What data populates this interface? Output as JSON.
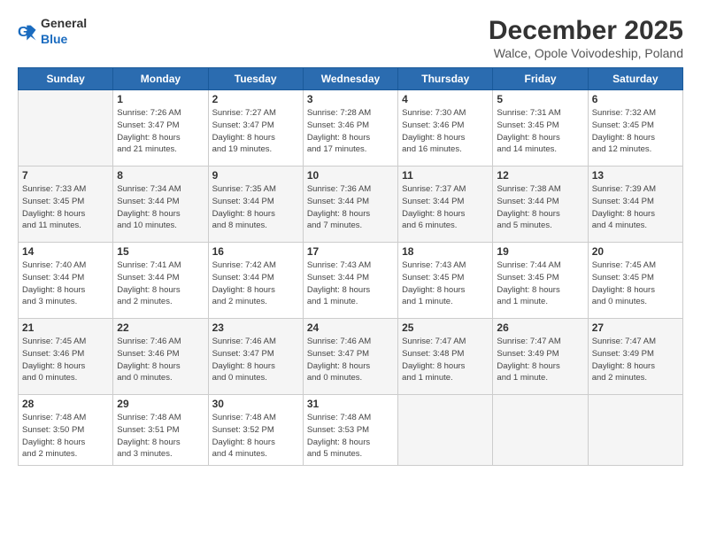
{
  "logo": {
    "general": "General",
    "blue": "Blue"
  },
  "header": {
    "month_year": "December 2025",
    "location": "Walce, Opole Voivodeship, Poland"
  },
  "days_of_week": [
    "Sunday",
    "Monday",
    "Tuesday",
    "Wednesday",
    "Thursday",
    "Friday",
    "Saturday"
  ],
  "weeks": [
    [
      {
        "day": "",
        "info": ""
      },
      {
        "day": "1",
        "info": "Sunrise: 7:26 AM\nSunset: 3:47 PM\nDaylight: 8 hours\nand 21 minutes."
      },
      {
        "day": "2",
        "info": "Sunrise: 7:27 AM\nSunset: 3:47 PM\nDaylight: 8 hours\nand 19 minutes."
      },
      {
        "day": "3",
        "info": "Sunrise: 7:28 AM\nSunset: 3:46 PM\nDaylight: 8 hours\nand 17 minutes."
      },
      {
        "day": "4",
        "info": "Sunrise: 7:30 AM\nSunset: 3:46 PM\nDaylight: 8 hours\nand 16 minutes."
      },
      {
        "day": "5",
        "info": "Sunrise: 7:31 AM\nSunset: 3:45 PM\nDaylight: 8 hours\nand 14 minutes."
      },
      {
        "day": "6",
        "info": "Sunrise: 7:32 AM\nSunset: 3:45 PM\nDaylight: 8 hours\nand 12 minutes."
      }
    ],
    [
      {
        "day": "7",
        "info": "Sunrise: 7:33 AM\nSunset: 3:45 PM\nDaylight: 8 hours\nand 11 minutes."
      },
      {
        "day": "8",
        "info": "Sunrise: 7:34 AM\nSunset: 3:44 PM\nDaylight: 8 hours\nand 10 minutes."
      },
      {
        "day": "9",
        "info": "Sunrise: 7:35 AM\nSunset: 3:44 PM\nDaylight: 8 hours\nand 8 minutes."
      },
      {
        "day": "10",
        "info": "Sunrise: 7:36 AM\nSunset: 3:44 PM\nDaylight: 8 hours\nand 7 minutes."
      },
      {
        "day": "11",
        "info": "Sunrise: 7:37 AM\nSunset: 3:44 PM\nDaylight: 8 hours\nand 6 minutes."
      },
      {
        "day": "12",
        "info": "Sunrise: 7:38 AM\nSunset: 3:44 PM\nDaylight: 8 hours\nand 5 minutes."
      },
      {
        "day": "13",
        "info": "Sunrise: 7:39 AM\nSunset: 3:44 PM\nDaylight: 8 hours\nand 4 minutes."
      }
    ],
    [
      {
        "day": "14",
        "info": "Sunrise: 7:40 AM\nSunset: 3:44 PM\nDaylight: 8 hours\nand 3 minutes."
      },
      {
        "day": "15",
        "info": "Sunrise: 7:41 AM\nSunset: 3:44 PM\nDaylight: 8 hours\nand 2 minutes."
      },
      {
        "day": "16",
        "info": "Sunrise: 7:42 AM\nSunset: 3:44 PM\nDaylight: 8 hours\nand 2 minutes."
      },
      {
        "day": "17",
        "info": "Sunrise: 7:43 AM\nSunset: 3:44 PM\nDaylight: 8 hours\nand 1 minute."
      },
      {
        "day": "18",
        "info": "Sunrise: 7:43 AM\nSunset: 3:45 PM\nDaylight: 8 hours\nand 1 minute."
      },
      {
        "day": "19",
        "info": "Sunrise: 7:44 AM\nSunset: 3:45 PM\nDaylight: 8 hours\nand 1 minute."
      },
      {
        "day": "20",
        "info": "Sunrise: 7:45 AM\nSunset: 3:45 PM\nDaylight: 8 hours\nand 0 minutes."
      }
    ],
    [
      {
        "day": "21",
        "info": "Sunrise: 7:45 AM\nSunset: 3:46 PM\nDaylight: 8 hours\nand 0 minutes."
      },
      {
        "day": "22",
        "info": "Sunrise: 7:46 AM\nSunset: 3:46 PM\nDaylight: 8 hours\nand 0 minutes."
      },
      {
        "day": "23",
        "info": "Sunrise: 7:46 AM\nSunset: 3:47 PM\nDaylight: 8 hours\nand 0 minutes."
      },
      {
        "day": "24",
        "info": "Sunrise: 7:46 AM\nSunset: 3:47 PM\nDaylight: 8 hours\nand 0 minutes."
      },
      {
        "day": "25",
        "info": "Sunrise: 7:47 AM\nSunset: 3:48 PM\nDaylight: 8 hours\nand 1 minute."
      },
      {
        "day": "26",
        "info": "Sunrise: 7:47 AM\nSunset: 3:49 PM\nDaylight: 8 hours\nand 1 minute."
      },
      {
        "day": "27",
        "info": "Sunrise: 7:47 AM\nSunset: 3:49 PM\nDaylight: 8 hours\nand 2 minutes."
      }
    ],
    [
      {
        "day": "28",
        "info": "Sunrise: 7:48 AM\nSunset: 3:50 PM\nDaylight: 8 hours\nand 2 minutes."
      },
      {
        "day": "29",
        "info": "Sunrise: 7:48 AM\nSunset: 3:51 PM\nDaylight: 8 hours\nand 3 minutes."
      },
      {
        "day": "30",
        "info": "Sunrise: 7:48 AM\nSunset: 3:52 PM\nDaylight: 8 hours\nand 4 minutes."
      },
      {
        "day": "31",
        "info": "Sunrise: 7:48 AM\nSunset: 3:53 PM\nDaylight: 8 hours\nand 5 minutes."
      },
      {
        "day": "",
        "info": ""
      },
      {
        "day": "",
        "info": ""
      },
      {
        "day": "",
        "info": ""
      }
    ]
  ]
}
